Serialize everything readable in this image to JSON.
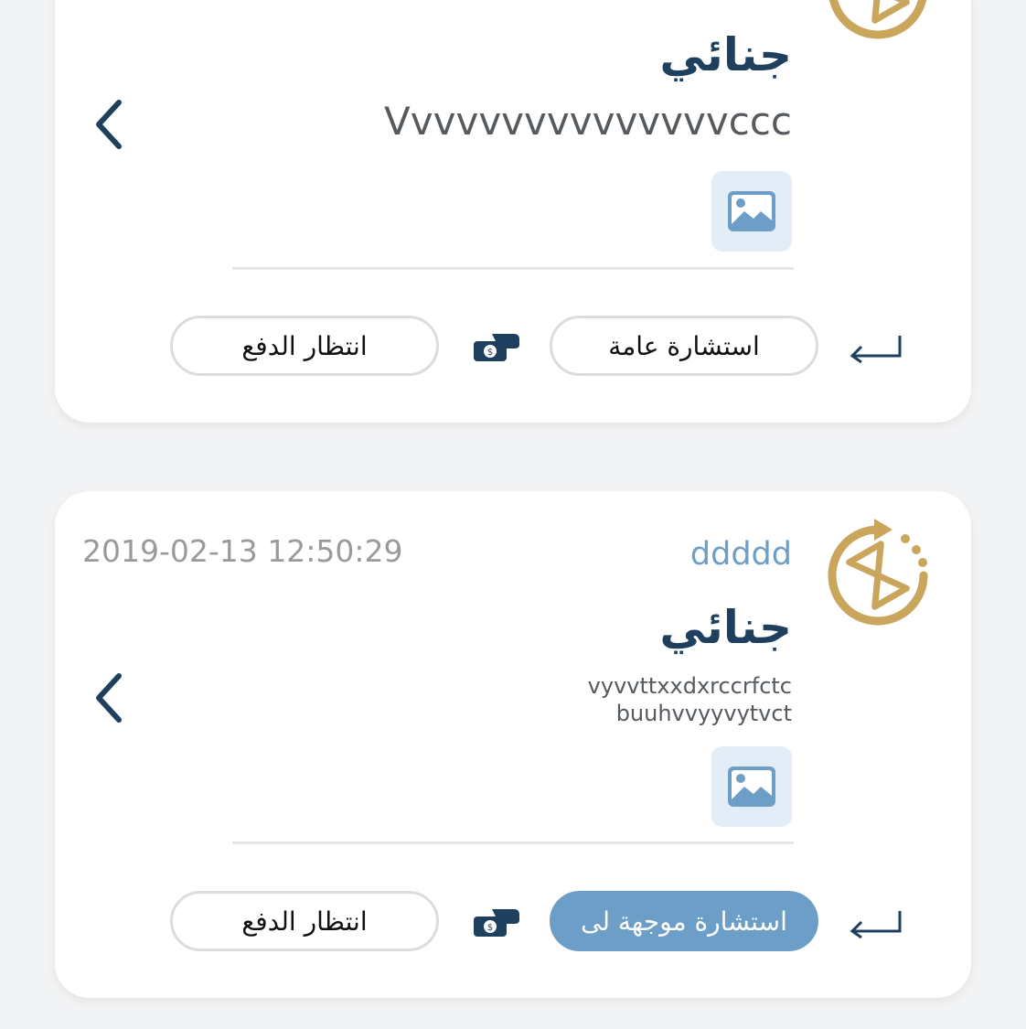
{
  "cases": [
    {
      "category": "جنائي",
      "description": "Vvvvvvvvvvvvvvvccc",
      "consultation_type": "استشارة عامة",
      "payment_status": "انتظار الدفع"
    },
    {
      "sender": "ddddd",
      "timestamp": "2019-02-13 12:50:29",
      "category": "جنائي",
      "description_line1": "vyvvttxxdxrccrfctc",
      "description_line2": "buuhvvyyvytvct",
      "consultation_type": "استشارة موجهة لى",
      "payment_status": "انتظار الدفع"
    }
  ],
  "icons": {
    "status": "hourglass-refresh-icon",
    "attachment": "image-icon",
    "reply": "reply-arrow-icon",
    "payment": "hand-money-icon",
    "open": "chevron-left-icon"
  },
  "colors": {
    "gold": "#c9a65b",
    "navy": "#1f3f5f",
    "accent_blue": "#6d9ec8",
    "background": "#f2f3f4"
  }
}
